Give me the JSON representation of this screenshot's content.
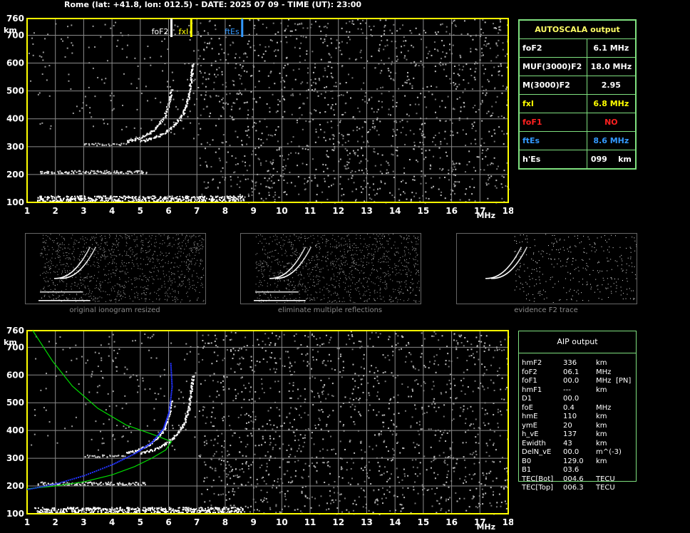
{
  "header": {
    "title": "Rome (lat: +41.8, lon: 012.5) - DATE: 2025 07 09 - TIME (UT): 23:00"
  },
  "colors": {
    "axis": "#ffff00",
    "grid": "#8a8a8a",
    "panel_border": "#7fe07f",
    "foF2": "#ffffff",
    "fxI": "#ffff00",
    "ftEs": "#3399ff",
    "foF1": "#ff2020",
    "profile": "#00dd00",
    "aip_trace": "#2233ff"
  },
  "chart_data": [
    {
      "type": "scatter",
      "name_id": "ionogram-top",
      "x_ticks": [
        "1",
        "2",
        "3",
        "4",
        "5",
        "6",
        "7",
        "8",
        "9",
        "10",
        "11",
        "12",
        "13",
        "14",
        "15",
        "16",
        "17",
        "18"
      ],
      "y_ticks": [
        "100",
        "200",
        "300",
        "400",
        "500",
        "600",
        "700",
        "760"
      ],
      "xlabel": "MHz",
      "ylabel": "km",
      "xlim": [
        1,
        18
      ],
      "ylim": [
        100,
        760
      ],
      "grid": true,
      "markers": [
        {
          "label": "foF2",
          "x": 6.1,
          "color": "#ffffff"
        },
        {
          "label": "fxI",
          "x": 6.8,
          "color": "#ffff00"
        },
        {
          "label": "ftEs",
          "x": 8.6,
          "color": "#3399ff"
        }
      ],
      "traces": {
        "o_trace": [
          [
            4.5,
            320
          ],
          [
            4.9,
            330
          ],
          [
            5.3,
            350
          ],
          [
            5.6,
            375
          ],
          [
            5.85,
            410
          ],
          [
            6.0,
            460
          ],
          [
            6.1,
            510
          ]
        ],
        "x_trace": [
          [
            5.0,
            320
          ],
          [
            5.5,
            335
          ],
          [
            5.9,
            355
          ],
          [
            6.2,
            380
          ],
          [
            6.5,
            420
          ],
          [
            6.7,
            480
          ],
          [
            6.8,
            560
          ],
          [
            6.85,
            600
          ]
        ],
        "es_layer": [
          [
            1.4,
            210
          ],
          [
            5.2,
            210
          ]
        ],
        "e_layer": [
          [
            1.3,
            115
          ],
          [
            8.6,
            115
          ]
        ],
        "f_low": [
          [
            3.0,
            310
          ],
          [
            4.5,
            310
          ]
        ]
      }
    },
    {
      "type": "scatter",
      "name_id": "ionogram-bottom",
      "x_ticks": [
        "1",
        "2",
        "3",
        "4",
        "5",
        "6",
        "7",
        "8",
        "9",
        "10",
        "11",
        "12",
        "13",
        "14",
        "15",
        "16",
        "17",
        "18"
      ],
      "y_ticks": [
        "100",
        "200",
        "300",
        "400",
        "500",
        "600",
        "700",
        "760"
      ],
      "xlabel": "MHz",
      "ylabel": "km",
      "xlim": [
        1,
        18
      ],
      "ylim": [
        100,
        760
      ],
      "grid": true,
      "profile_curve": [
        [
          1.0,
          190
        ],
        [
          2.0,
          200
        ],
        [
          3.0,
          215
        ],
        [
          4.0,
          240
        ],
        [
          4.8,
          270
        ],
        [
          5.4,
          300
        ],
        [
          5.9,
          330
        ],
        [
          6.1,
          360
        ],
        [
          5.6,
          380
        ],
        [
          4.5,
          420
        ],
        [
          3.5,
          480
        ],
        [
          2.6,
          560
        ],
        [
          1.9,
          650
        ],
        [
          1.2,
          760
        ]
      ],
      "aip_trace": [
        [
          1.0,
          190
        ],
        [
          2.0,
          210
        ],
        [
          3.0,
          240
        ],
        [
          4.0,
          280
        ],
        [
          4.8,
          320
        ],
        [
          5.4,
          360
        ],
        [
          5.8,
          410
        ],
        [
          6.0,
          470
        ],
        [
          6.1,
          560
        ],
        [
          6.05,
          650
        ]
      ],
      "traces": {
        "o_trace": [
          [
            4.5,
            320
          ],
          [
            4.9,
            330
          ],
          [
            5.3,
            350
          ],
          [
            5.6,
            375
          ],
          [
            5.85,
            410
          ],
          [
            6.0,
            460
          ],
          [
            6.1,
            510
          ]
        ],
        "x_trace": [
          [
            5.0,
            320
          ],
          [
            5.5,
            335
          ],
          [
            5.9,
            355
          ],
          [
            6.2,
            380
          ],
          [
            6.5,
            420
          ],
          [
            6.7,
            480
          ],
          [
            6.8,
            560
          ],
          [
            6.85,
            600
          ]
        ],
        "es_layer": [
          [
            1.4,
            210
          ],
          [
            5.2,
            210
          ]
        ],
        "e_layer": [
          [
            1.3,
            115
          ],
          [
            8.6,
            115
          ]
        ],
        "f_low": [
          [
            3.0,
            310
          ],
          [
            4.5,
            310
          ]
        ]
      }
    }
  ],
  "autoscala": {
    "title": "AUTOSCALA output",
    "rows": [
      {
        "label": "foF2",
        "value": "6.1 MHz",
        "color": "#ffffff"
      },
      {
        "label": "MUF(3000)F2",
        "value": "18.0 MHz",
        "color": "#ffffff"
      },
      {
        "label": "M(3000)F2",
        "value": "2.95",
        "color": "#ffffff"
      },
      {
        "label": "fxI",
        "value": "6.8 MHz",
        "color": "#ffff00"
      },
      {
        "label": "foF1",
        "value": "NO",
        "color": "#ff2020"
      },
      {
        "label": "ftEs",
        "value": "8.6 MHz",
        "color": "#3399ff"
      },
      {
        "label": "h'Es",
        "value": "099    km",
        "color": "#ffffff"
      }
    ]
  },
  "thumbnails": [
    {
      "caption": "original ionogram resized"
    },
    {
      "caption": "eliminate multiple reflections"
    },
    {
      "caption": "evidence F2 trace"
    }
  ],
  "aip": {
    "title": "AIP output",
    "rows": [
      {
        "label": "hmF2",
        "value": "336",
        "unit": "km",
        "extra": ""
      },
      {
        "label": "foF2",
        "value": "06.1",
        "unit": "MHz",
        "extra": ""
      },
      {
        "label": "foF1",
        "value": "00.0",
        "unit": "MHz",
        "extra": "[PN]"
      },
      {
        "label": "hmF1",
        "value": "---",
        "unit": "km",
        "extra": ""
      },
      {
        "label": "D1",
        "value": "00.0",
        "unit": "",
        "extra": ""
      },
      {
        "label": "foE",
        "value": "0.4",
        "unit": "MHz",
        "extra": ""
      },
      {
        "label": "hmE",
        "value": "110",
        "unit": "km",
        "extra": ""
      },
      {
        "label": "ymE",
        "value": "20",
        "unit": "km",
        "extra": ""
      },
      {
        "label": "h_vE",
        "value": "137",
        "unit": "km",
        "extra": ""
      },
      {
        "label": "Ewidth",
        "value": "43",
        "unit": "km",
        "extra": ""
      },
      {
        "label": "DelN_vE",
        "value": "00.0",
        "unit": "m^(-3)",
        "extra": ""
      },
      {
        "label": "B0",
        "value": "129.0",
        "unit": "km",
        "extra": ""
      },
      {
        "label": "B1",
        "value": "03.6",
        "unit": "",
        "extra": ""
      },
      {
        "label": "TEC[Bot]",
        "value": "004.6",
        "unit": "TECU",
        "extra": ""
      },
      {
        "label": "TEC[Top]",
        "value": "006.3",
        "unit": "TECU",
        "extra": ""
      }
    ]
  }
}
